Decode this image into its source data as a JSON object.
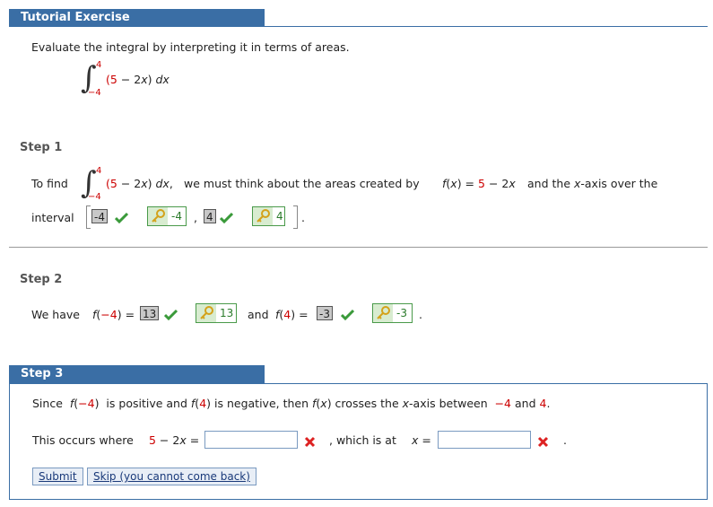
{
  "tutorial": {
    "title": "Tutorial Exercise",
    "instruction": "Evaluate the integral by interpreting it in terms of areas.",
    "integral": {
      "lower": "−4",
      "upper": "4",
      "integrand": "(5 − 2x) dx"
    }
  },
  "step1": {
    "title": "Step 1",
    "to_find": "To find",
    "integrand": "(5 − 2x) dx,",
    "text_middle": "we must think about the areas created by",
    "fx": "f(x) =",
    "fx_expr": "5 − 2x",
    "text_end": "and the x-axis over the",
    "interval_label": "interval",
    "entered_lower": "-4",
    "key_lower": "-4",
    "comma": ",",
    "entered_upper": "4",
    "key_upper": "4",
    "period": "."
  },
  "step2": {
    "title": "Step 2",
    "we_have": "We have",
    "f_neg4": "f(−4) =",
    "entered_neg4": "13",
    "key_neg4": "13",
    "and": "and",
    "f_4": "f(4) =",
    "entered_4": "-3",
    "key_4": "-3",
    "period": "."
  },
  "step3": {
    "title": "Step 3",
    "since_a": "Since",
    "since_fneg4": "f(−4)",
    "since_b": "is positive and",
    "since_f4": "f(4)",
    "since_c": "is negative, then",
    "since_fx": "f(x)",
    "since_d": "crosses the x-axis between",
    "since_neg4": "−4",
    "since_and": "and",
    "since_4": "4.",
    "occurs_label": "This occurs where",
    "occurs_expr": "5 − 2x =",
    "occurs_value": "",
    "which_label": ", which is at",
    "which_x": "x =",
    "which_value": "",
    "period": ".",
    "submit_label": "Submit",
    "skip_label": "Skip (you cannot come back)"
  },
  "colors": {
    "header_blue": "#3a6ea5",
    "accent_red": "#cc0000",
    "check_green": "#3a9a3a"
  }
}
